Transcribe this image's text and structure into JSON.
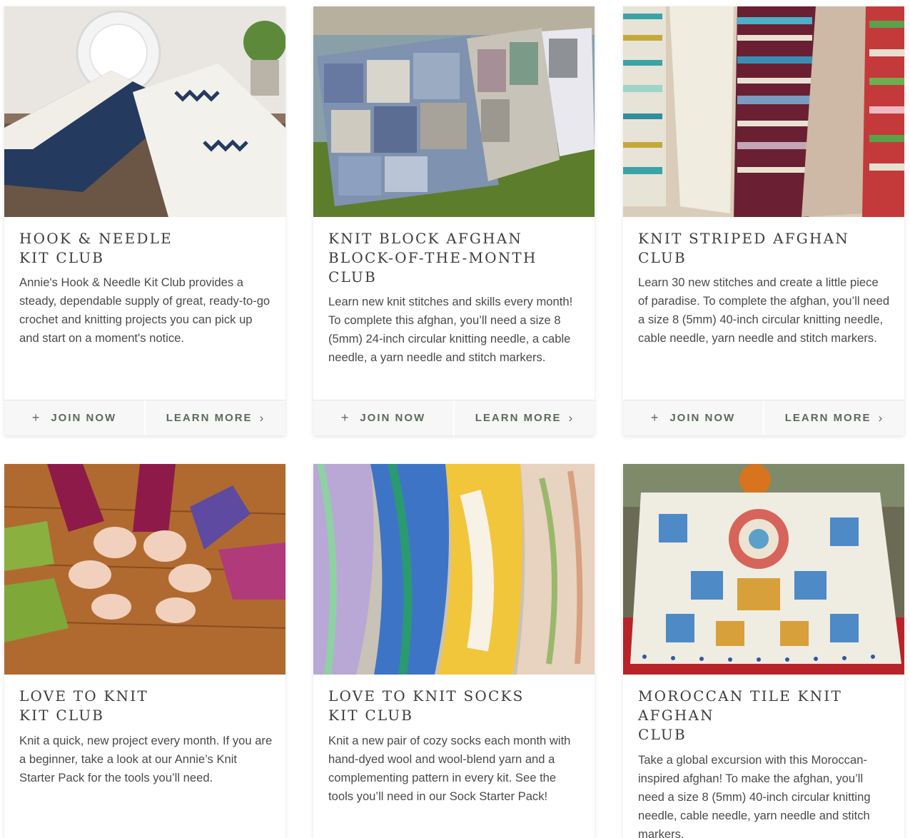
{
  "cards": [
    {
      "title": "HOOK & NEEDLE\nKIT CLUB",
      "description": "Annie's Hook & Needle Kit Club provides a steady, dependable supply of great, ready-to-go crochet and knitting projects you can pick up and start on a moment's notice.",
      "join_label": "JOIN NOW",
      "learn_label": "LEARN MORE"
    },
    {
      "title": "KNIT BLOCK AFGHAN\nBLOCK-OF-THE-MONTH\nCLUB",
      "description": "Learn new knit stitches and skills every month! To complete this afghan, you’ll need a size 8 (5mm) 24-inch circular knitting needle, a cable needle, a yarn needle and stitch markers.",
      "join_label": "JOIN NOW",
      "learn_label": "LEARN MORE"
    },
    {
      "title": "KNIT STRIPED AFGHAN\nCLUB",
      "description": "Learn 30 new stitches and create a little piece of paradise. To complete the afghan, you’ll need a size 8 (5mm) 40-inch circular knitting needle, cable needle, yarn needle and stitch markers.",
      "join_label": "JOIN NOW",
      "learn_label": "LEARN MORE"
    },
    {
      "title": "LOVE TO KNIT\nKIT CLUB",
      "description": "Knit a quick, new project every month. If you are a beginner, take a look at our Annie’s Knit Starter Pack for the tools you’ll need."
    },
    {
      "title": "LOVE TO KNIT SOCKS\nKIT CLUB",
      "description": "Knit a new pair of cozy socks each month with hand-dyed wool and wool-blend yarn and a complementing pattern in every kit. See the tools you’ll need in our Sock Starter Pack!"
    },
    {
      "title": "MOROCCAN TILE KNIT\nAFGHAN\nCLUB",
      "description": "Take a global excursion with this Moroccan-inspired afghan! To make the afghan, you’ll need a size 8 (5mm) 40-inch circular knitting needle, cable needle, yarn needle and stitch markers."
    }
  ],
  "icons": {
    "join": "plus-icon",
    "learn": "chevron-right-icon"
  },
  "colors": {
    "button_text": "#5b6b5a",
    "button_bg": "#f7f7f7",
    "title_text": "#3e3e3e"
  }
}
